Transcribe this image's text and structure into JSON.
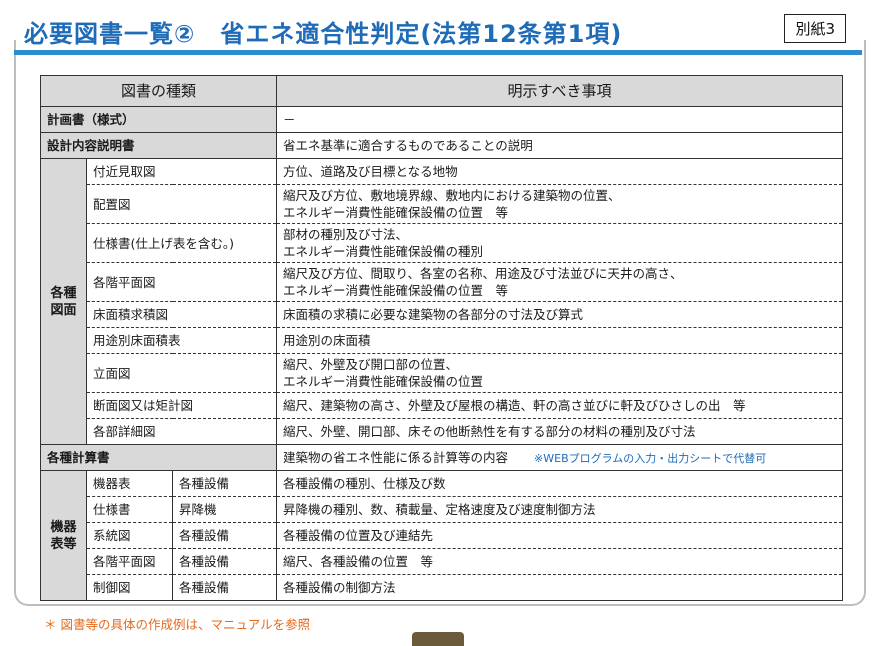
{
  "header": {
    "title": "必要図書一覧②　省エネ適合性判定(法第12条第1項)",
    "attachment": "別紙3"
  },
  "table": {
    "col_type": "図書の種類",
    "col_items": "明示すべき事項",
    "rows": {
      "keikakusho": {
        "label": "計画書（様式）",
        "desc": "－"
      },
      "setsumei": {
        "label": "設計内容説明書",
        "desc": "省エネ基準に適合するものであることの説明"
      },
      "zumen_category": "各種図面",
      "zumen": [
        {
          "label": "付近見取図",
          "desc1": "方位、道路及び目標となる地物",
          "desc2": ""
        },
        {
          "label": "配置図",
          "desc1": "縮尺及び方位、敷地境界線、敷地内における建築物の位置、",
          "desc2": "エネルギー消費性能確保設備の位置　等"
        },
        {
          "label": "仕様書(仕上げ表を含む。)",
          "desc1": "部材の種別及び寸法、",
          "desc2": "エネルギー消費性能確保設備の種別"
        },
        {
          "label": "各階平面図",
          "desc1": "縮尺及び方位、間取り、各室の名称、用途及び寸法並びに天井の高さ、",
          "desc2": "エネルギー消費性能確保設備の位置　等"
        },
        {
          "label": "床面積求積図",
          "desc1": "床面積の求積に必要な建築物の各部分の寸法及び算式",
          "desc2": ""
        },
        {
          "label": "用途別床面積表",
          "desc1": "用途別の床面積",
          "desc2": ""
        },
        {
          "label": "立面図",
          "desc1": "縮尺、外壁及び開口部の位置、",
          "desc2": "エネルギー消費性能確保設備の位置"
        },
        {
          "label": "断面図又は矩計図",
          "desc1": "縮尺、建築物の高さ、外壁及び屋根の構造、軒の高さ並びに軒及びひさしの出　等",
          "desc2": ""
        },
        {
          "label": "各部詳細図",
          "desc1": "縮尺、外壁、開口部、床その他断熱性を有する部分の材料の種別及び寸法",
          "desc2": ""
        }
      ],
      "keisan": {
        "label": "各種計算書",
        "desc": "建築物の省エネ性能に係る計算等の内容",
        "note": "※WEBプログラムの入力・出力シートで代替可"
      },
      "kiki_category": "機器表等",
      "kiki": [
        {
          "label": "機器表",
          "sub": "各種設備",
          "desc": "各種設備の種別、仕様及び数"
        },
        {
          "label": "仕様書",
          "sub": "昇降機",
          "desc": "昇降機の種別、数、積載量、定格速度及び速度制御方法"
        },
        {
          "label": "系統図",
          "sub": "各種設備",
          "desc": "各種設備の位置及び連結先"
        },
        {
          "label": "各階平面図",
          "sub": "各種設備",
          "desc": "縮尺、各種設備の位置　等"
        },
        {
          "label": "制御図",
          "sub": "各種設備",
          "desc": "各種設備の制御方法"
        }
      ]
    }
  },
  "footnote": "＊ 図書等の具体の作成例は、マニュアルを参照"
}
